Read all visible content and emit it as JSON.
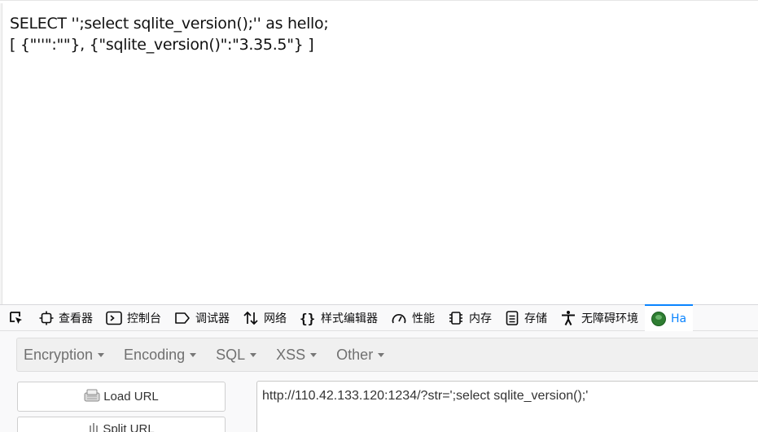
{
  "page": {
    "lines": [
      "SELECT '';select sqlite_version();'' as hello;",
      "[ {\"''\":\"\"}, {\"sqlite_version()\":\"3.35.5\"} ]"
    ]
  },
  "devtools": {
    "tabs": [
      {
        "label": "查看器",
        "icon": "inspector-icon"
      },
      {
        "label": "控制台",
        "icon": "console-icon"
      },
      {
        "label": "调试器",
        "icon": "debugger-icon"
      },
      {
        "label": "网络",
        "icon": "network-icon"
      },
      {
        "label": "样式编辑器",
        "icon": "style-editor-icon"
      },
      {
        "label": "性能",
        "icon": "performance-icon"
      },
      {
        "label": "内存",
        "icon": "memory-icon"
      },
      {
        "label": "存储",
        "icon": "storage-icon"
      },
      {
        "label": "无障碍环境",
        "icon": "accessibility-icon"
      },
      {
        "label": "Ha",
        "icon": "hackbar-icon"
      }
    ],
    "active_color": "#0a84ff"
  },
  "hackbar": {
    "menu": [
      "Encryption",
      "Encoding",
      "SQL",
      "XSS",
      "Other"
    ],
    "load_url_label": "Load URL",
    "split_url_label": "Split URL",
    "url_value": "http://110.42.133.120:1234/?str=';select sqlite_version();'"
  }
}
